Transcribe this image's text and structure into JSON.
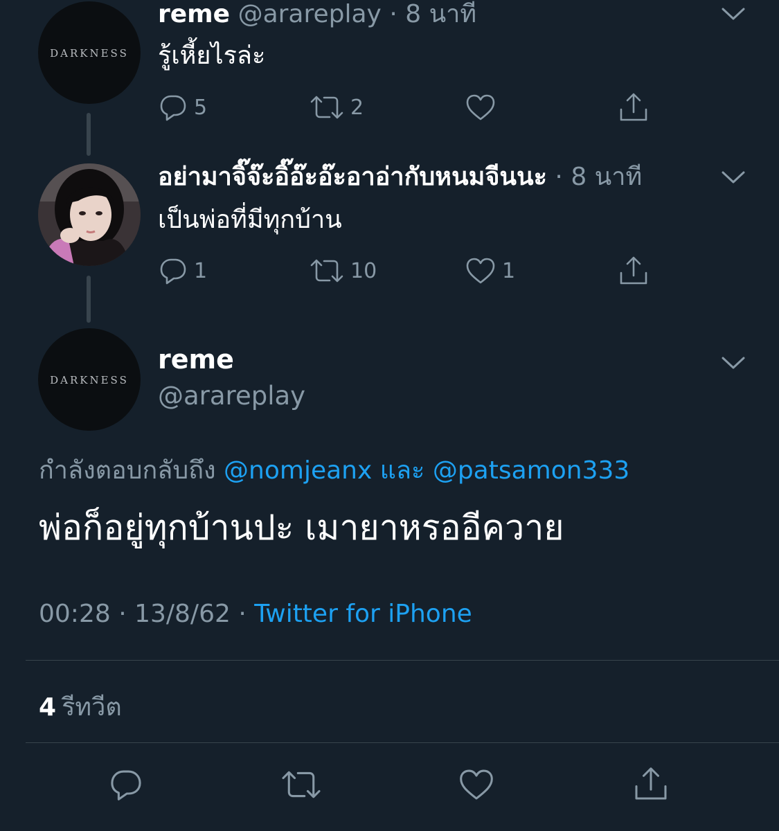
{
  "colors": {
    "background": "#15202b",
    "muted": "#8899a6",
    "link": "#1da1f2",
    "divider": "#38444d"
  },
  "tweet1": {
    "avatar_text": "DARKNESS",
    "name": "reme",
    "handle": "@arareplay",
    "sep": " · ",
    "time": "8 นาที",
    "text": "รู้เหี้ยไรล่ะ",
    "reply_count": "5",
    "retweet_count": "2",
    "like_count": "",
    "icons": [
      "reply-icon",
      "retweet-icon",
      "like-icon",
      "share-icon",
      "chevron-down-icon"
    ]
  },
  "tweet2": {
    "name": "อย่ามาจิ๊จ๊ะอิ๊อ๊ะอ๊ะอาอ่ากับหนมจีนนะ",
    "sep": " · ",
    "time": "8 นาที",
    "text": "เป็นพ่อที่มีทุกบ้าน",
    "reply_count": "1",
    "retweet_count": "10",
    "like_count": "1"
  },
  "main": {
    "avatar_text": "DARKNESS",
    "name": "reme",
    "handle": "@arareplay",
    "replying_label": "กำลังตอบกลับถึง",
    "reply_user1": "@nomjeanx",
    "reply_and": "และ",
    "reply_user2": "@patsamon333",
    "text": "พ่อก็อยู่ทุกบ้านปะ เมายาหรออีควาย",
    "time": "00:28",
    "sep": " · ",
    "date": "13/8/62",
    "source": "Twitter for iPhone",
    "retweet_count": "4",
    "retweet_label": "รีทวีต"
  }
}
